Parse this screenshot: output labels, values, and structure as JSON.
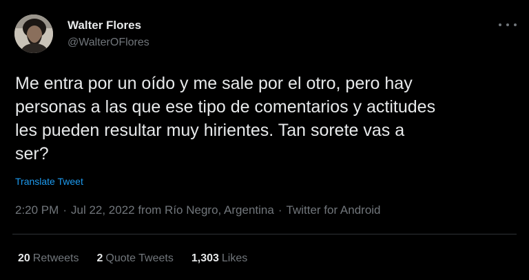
{
  "author": {
    "name": "Walter Flores",
    "handle": "@WalterOFlores",
    "avatar_icon": "profile-photo"
  },
  "tweet": {
    "text": "Me entra por un oído y me sale por el otro, pero hay\npersonas a las que ese tipo de comentarios y actitudes\nles pueden resultar muy hirientes. Tan sorete vas a\nser?",
    "translate_label": "Translate Tweet"
  },
  "meta": {
    "time": "2:20 PM",
    "date": "Jul 22, 2022 from Río Negro, Argentina",
    "client": "Twitter for Android",
    "separator": "·"
  },
  "stats": {
    "retweets_count": "20",
    "retweets_label": "Retweets",
    "quotes_count": "2",
    "quotes_label": "Quote Tweets",
    "likes_count": "1,303",
    "likes_label": "Likes"
  },
  "colors": {
    "background": "#000000",
    "text": "#e7e9ea",
    "secondary": "#71767b",
    "link": "#1d9bf0",
    "divider": "#2f3336"
  }
}
